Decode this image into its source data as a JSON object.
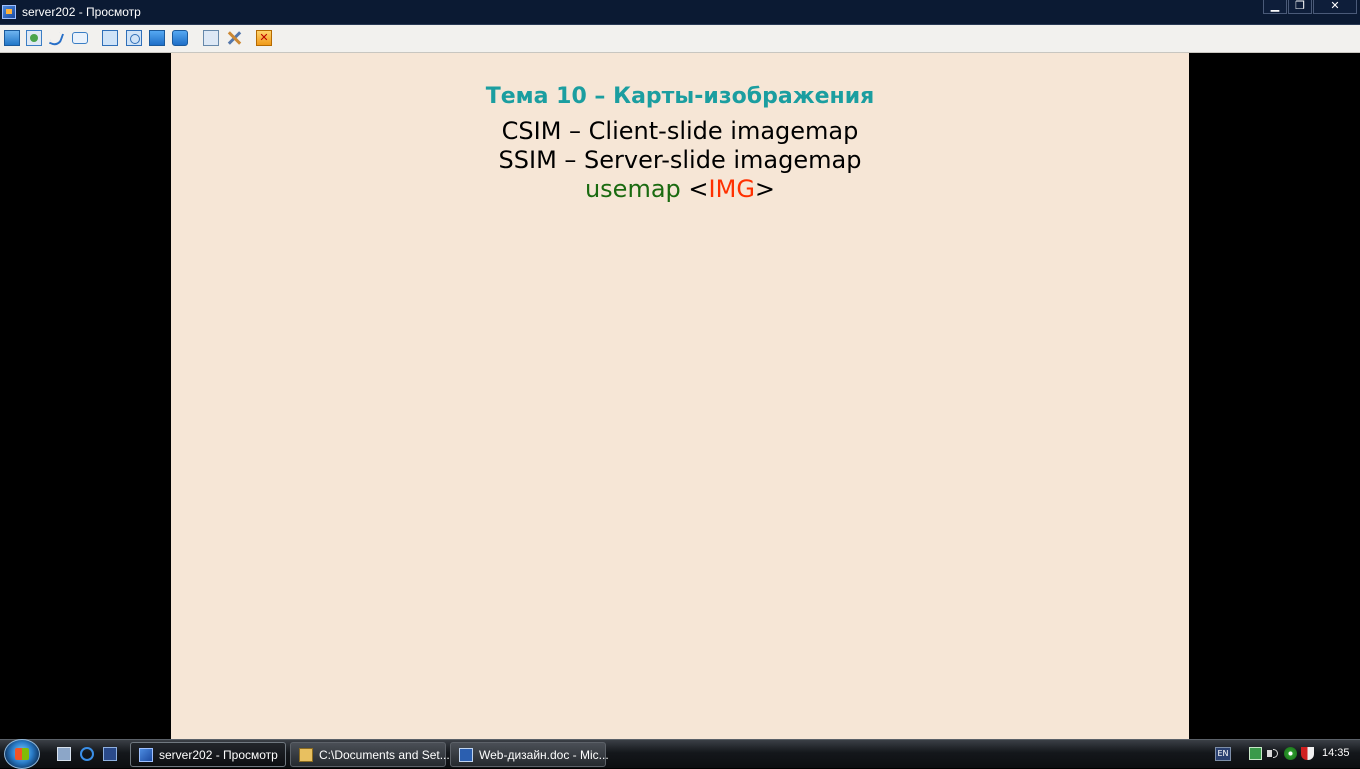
{
  "window": {
    "title": "server202 - Просмотр",
    "controls": {
      "minimize": "▁",
      "maximize": "❐",
      "close": "✕"
    }
  },
  "toolbar": {
    "icons": [
      "display-icon",
      "connect-icon",
      "call-icon",
      "chat-icon",
      "window-icon",
      "fullscreen-icon",
      "view-icon",
      "scale-icon",
      "transfer-icon",
      "tools-icon",
      "disconnect-icon"
    ]
  },
  "slide": {
    "title": "Тема 10 – Карты-изображения",
    "line1": "CSIM – Client-slide imagemap",
    "line2": "SSIM – Server-slide imagemap",
    "line3_keyword": "usemap",
    "line3_open": "<",
    "line3_tag": "IMG",
    "line3_close": ">",
    "colors": {
      "background": "#f6e6d6",
      "title": "#1b9ea0",
      "keyword": "#1a6a10",
      "tag": "#ff3000"
    }
  },
  "taskbar": {
    "tasks": [
      {
        "label": "server202 - Просмотр",
        "active": true
      },
      {
        "label": "C:\\Documents and Set...",
        "active": false
      },
      {
        "label": "Web-дизайн.doc - Mic...",
        "active": false
      }
    ],
    "tray": {
      "language": "EN",
      "clock": "14:35"
    }
  }
}
